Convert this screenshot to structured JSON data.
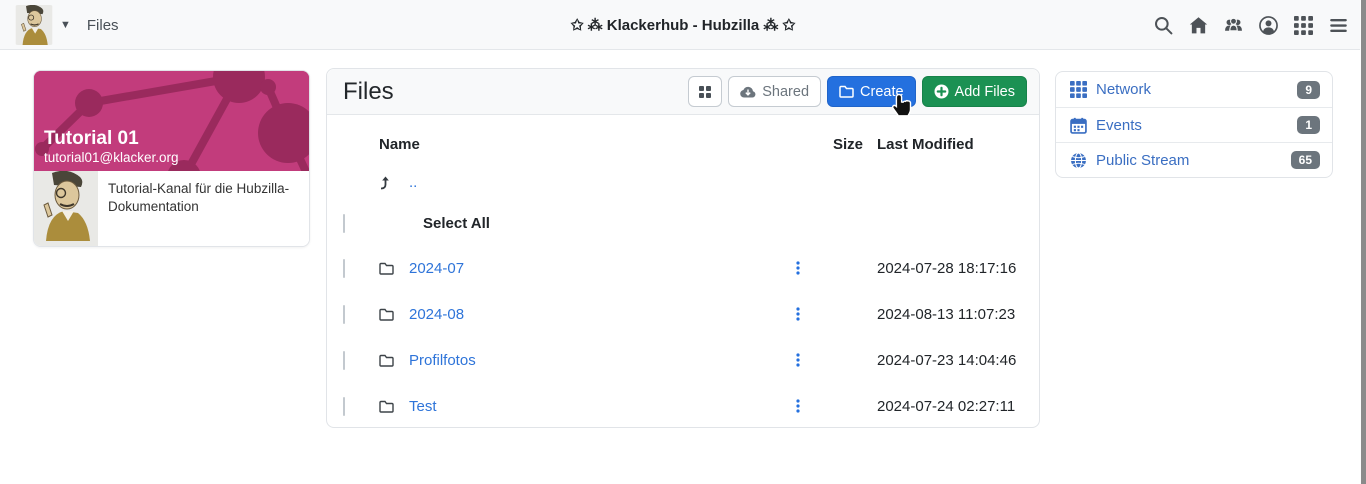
{
  "navbar": {
    "channel_menu_label": "Files",
    "title": "✩ ⁂ Klackerhub - Hubzilla ⁂ ✩",
    "icons": [
      "search-icon",
      "home-icon",
      "group-icon",
      "account-icon",
      "apps-grid-icon",
      "hamburger-menu-icon"
    ]
  },
  "profile_card": {
    "channel_name": "Tutorial 01",
    "channel_address": "tutorial01@klacker.org",
    "description": "Tutorial-Kanal für die Hubzilla-Dokumentation"
  },
  "main": {
    "heading": "Files",
    "toolbar": {
      "view_toggle_icon": "grid-view-icon",
      "shared_label": "Shared",
      "create_label": "Create",
      "add_files_label": "Add Files"
    },
    "table": {
      "headers": {
        "name": "Name",
        "size": "Size",
        "modified": "Last Modified"
      },
      "parent_link": "..",
      "select_all_label": "Select All",
      "rows": [
        {
          "name": "2024-07",
          "size": "",
          "modified": "2024-07-28 18:17:16"
        },
        {
          "name": "2024-08",
          "size": "",
          "modified": "2024-08-13 11:07:23"
        },
        {
          "name": "Profilfotos",
          "size": "",
          "modified": "2024-07-23 14:04:46"
        },
        {
          "name": "Test",
          "size": "",
          "modified": "2024-07-24 02:27:11"
        }
      ]
    }
  },
  "right_sidebar": {
    "items": [
      {
        "label": "Network",
        "count": "9"
      },
      {
        "label": "Events",
        "count": "1"
      },
      {
        "label": "Public Stream",
        "count": "65"
      }
    ]
  },
  "colors": {
    "primary_blue": "#2470df",
    "success_green": "#1b9153",
    "cover_magenta": "#c23c7c",
    "cover_pattern": "#9a2a5d",
    "badge_gray": "#6c757d",
    "link_blue": "#2e74d9",
    "sidebar_link_blue": "#3a6ec2",
    "navbar_bg": "#f8f9fa"
  }
}
